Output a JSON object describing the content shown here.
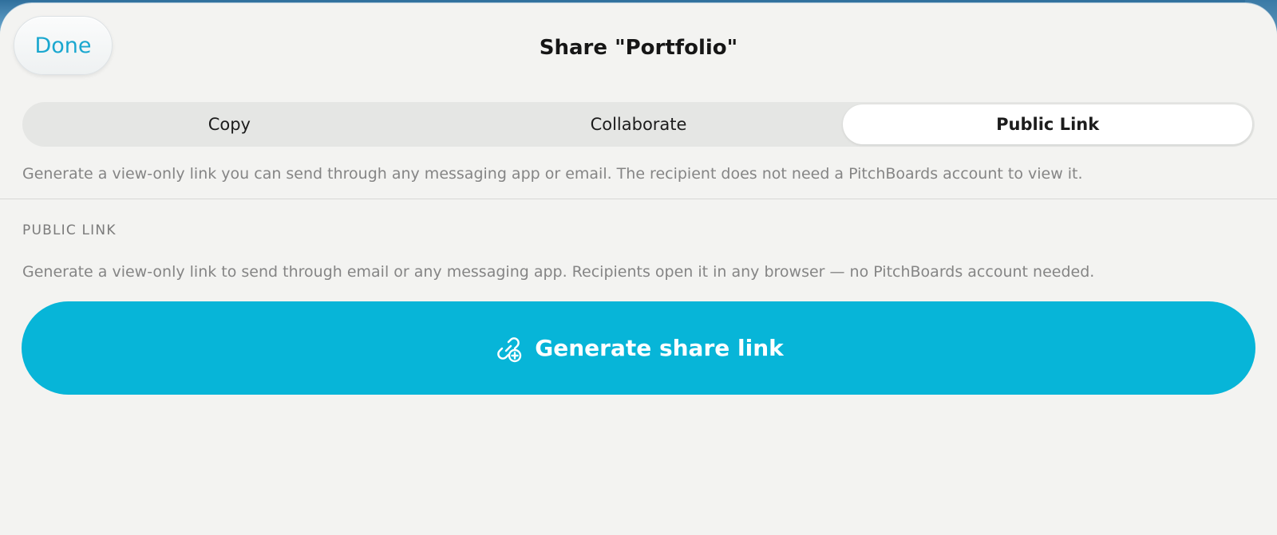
{
  "header": {
    "done_label": "Done",
    "title": "Share \"Portfolio\""
  },
  "tabs": [
    {
      "label": "Copy",
      "active": false
    },
    {
      "label": "Collaborate",
      "active": false
    },
    {
      "label": "Public Link",
      "active": true
    }
  ],
  "description": "Generate a view-only link you can send through any messaging app or email. The recipient does not need a PitchBoards account to view it.",
  "public_link": {
    "section_title": "PUBLIC LINK",
    "section_description": "Generate a view-only link to send through email or any messaging app. Recipients open it in any browser — no PitchBoards account needed.",
    "button_label": "Generate share link",
    "button_icon": "link-plus-icon"
  },
  "colors": {
    "accent": "#07b5d8",
    "done_text": "#1aa7cf",
    "sheet_background": "#f3f3f1"
  }
}
